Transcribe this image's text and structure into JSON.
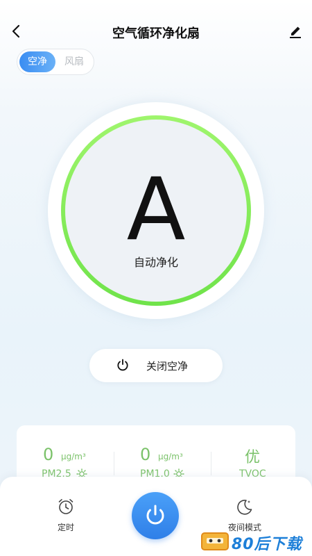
{
  "header": {
    "title": "空气循环净化扇",
    "back_icon": "chevron-left-icon",
    "edit_icon": "pencil-icon"
  },
  "mode_switch": {
    "tabs": [
      {
        "label": "空净",
        "active": true
      },
      {
        "label": "风扇",
        "active": false
      }
    ],
    "active_color": "#3a8df2"
  },
  "dial": {
    "mode_letter": "A",
    "mode_label": "自动净化",
    "ring_color": "#7fe85a"
  },
  "power_toggle": {
    "label": "关闭空净",
    "icon": "power-icon"
  },
  "stats": [
    {
      "value": "0",
      "unit": "μg/m³",
      "name": "PM2.5",
      "icon": "sun-icon"
    },
    {
      "value": "0",
      "unit": "μg/m³",
      "name": "PM1.0",
      "icon": "sun-icon"
    },
    {
      "value": "优",
      "unit": "",
      "name": "TVOC",
      "icon": ""
    }
  ],
  "stats_color": "#7bc26a",
  "bottom_bar": {
    "timer_label": "定时",
    "night_label": "夜间模式",
    "power_color": "#2f7fe8"
  },
  "watermark": {
    "text": "80后下载"
  }
}
